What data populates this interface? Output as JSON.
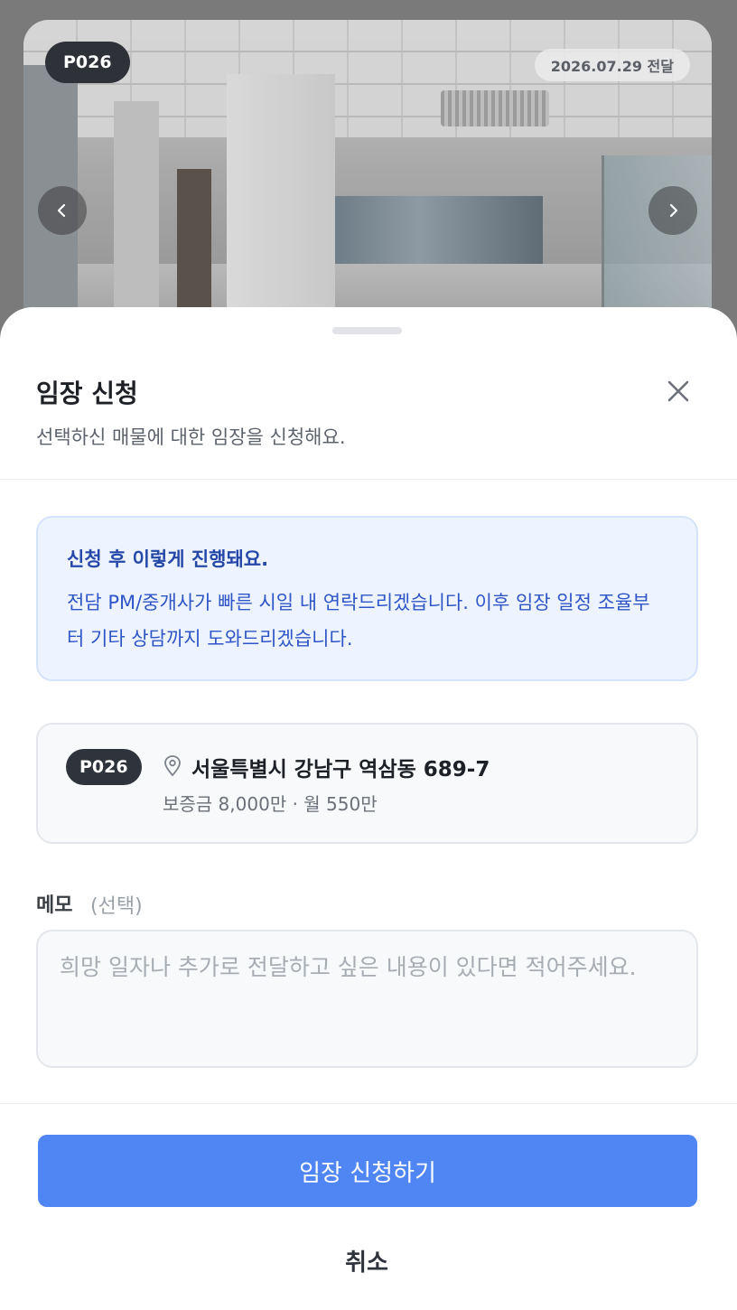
{
  "photo": {
    "id_tag": "P026",
    "date_tag": "2026.07.29 전달"
  },
  "sheet": {
    "title": "임장 신청",
    "subtitle": "선택하신 매물에 대한 임장을 신청해요."
  },
  "info": {
    "title": "신청 후 이렇게 진행돼요.",
    "body": "전담 PM/중개사가 빠른 시일 내 연락드리겠습니다. 이후 임장 일정 조율부터 기타 상담까지 도와드리겠습니다."
  },
  "property": {
    "id": "P026",
    "address": "서울특별시 강남구 역삼동 689-7",
    "price": "보증금 8,000만 · 월 550만"
  },
  "memo": {
    "label": "메모",
    "optional": "(선택)",
    "placeholder": "희망 일자나 추가로 전달하고 싶은 내용이 있다면 적어주세요.",
    "value": ""
  },
  "actions": {
    "submit": "임장 신청하기",
    "cancel": "취소"
  },
  "colors": {
    "primary": "#4f86f4",
    "info_bg": "#eef4ff",
    "info_text": "#2f55c7",
    "badge_dark": "#2f333b"
  }
}
